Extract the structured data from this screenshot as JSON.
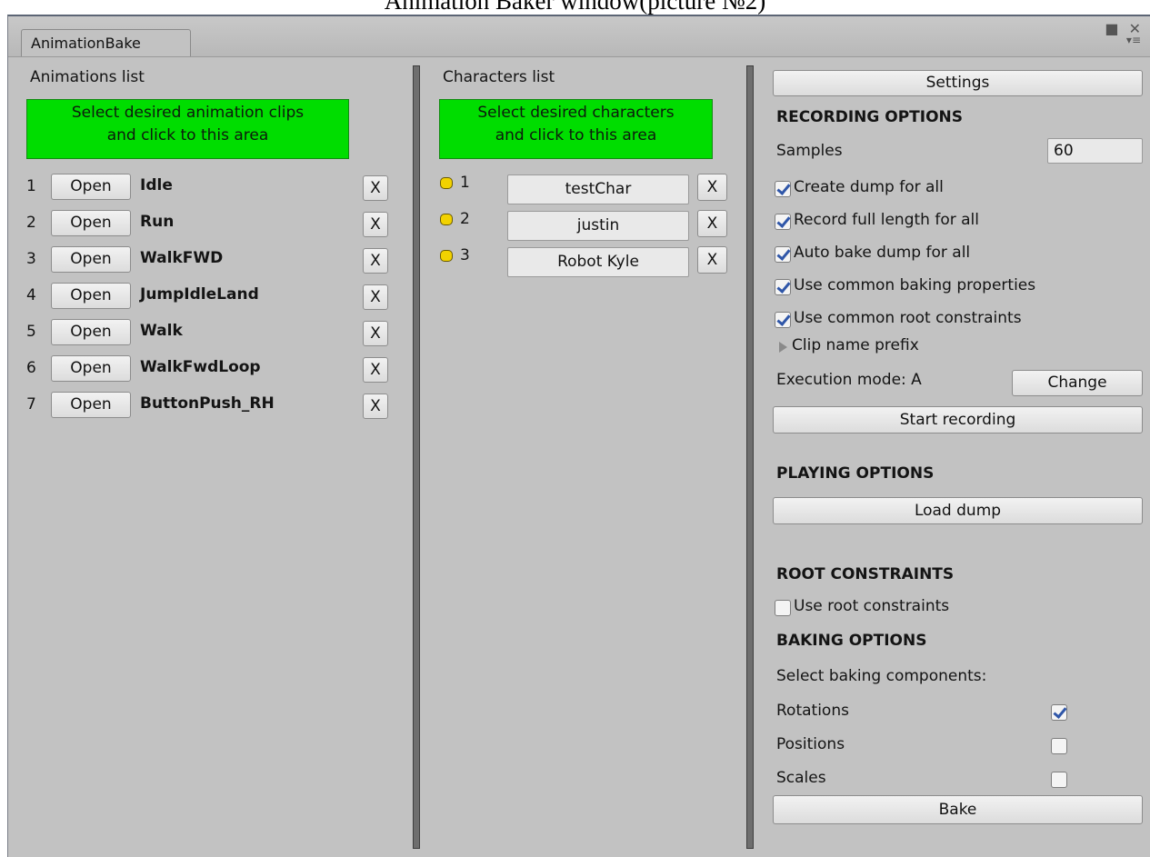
{
  "caption": "Animation Baker window(picture №2)",
  "window": {
    "tab_label": "AnimationBake",
    "icons": [
      "maximize-icon",
      "close-icon",
      "menu-icon"
    ]
  },
  "animations": {
    "header": "Animations list",
    "dropzone_line1": "Select desired animation clips",
    "dropzone_line2": "and click to this area",
    "open_label": "Open",
    "remove_label": "X",
    "items": [
      {
        "index": "1",
        "name": "Idle"
      },
      {
        "index": "2",
        "name": "Run"
      },
      {
        "index": "3",
        "name": "WalkFWD"
      },
      {
        "index": "4",
        "name": "JumpIdleLand"
      },
      {
        "index": "5",
        "name": "Walk"
      },
      {
        "index": "6",
        "name": "WalkFwdLoop"
      },
      {
        "index": "7",
        "name": "ButtonPush_RH"
      }
    ]
  },
  "characters": {
    "header": "Characters list",
    "dropzone_line1": "Select desired characters",
    "dropzone_line2": "and click to this area",
    "remove_label": "X",
    "status_color": "#f2d200",
    "items": [
      {
        "index": "1",
        "name": "testChar"
      },
      {
        "index": "2",
        "name": "justin"
      },
      {
        "index": "3",
        "name": "Robot Kyle"
      }
    ]
  },
  "settings": {
    "settings_button": "Settings",
    "recording_header": "RECORDING OPTIONS",
    "samples_label": "Samples",
    "samples_value": "60",
    "checks": [
      {
        "label": "Create dump for all",
        "checked": true
      },
      {
        "label": "Record full length for all",
        "checked": true
      },
      {
        "label": "Auto bake dump for all",
        "checked": true
      },
      {
        "label": "Use common baking properties",
        "checked": true
      },
      {
        "label": "Use common root constraints",
        "checked": true
      }
    ],
    "clip_prefix_label": "Clip name prefix",
    "execution_mode_label": "Execution mode: A",
    "change_button": "Change",
    "start_recording_button": "Start recording",
    "playing_header": "PLAYING OPTIONS",
    "load_dump_button": "Load dump",
    "root_header": "ROOT CONSTRAINTS",
    "use_root_label": "Use root constraints",
    "use_root_checked": false,
    "baking_header": "BAKING OPTIONS",
    "select_components_label": "Select baking components:",
    "components": [
      {
        "label": "Rotations",
        "checked": true
      },
      {
        "label": "Positions",
        "checked": false
      },
      {
        "label": "Scales",
        "checked": false
      }
    ],
    "bake_button": "Bake"
  }
}
